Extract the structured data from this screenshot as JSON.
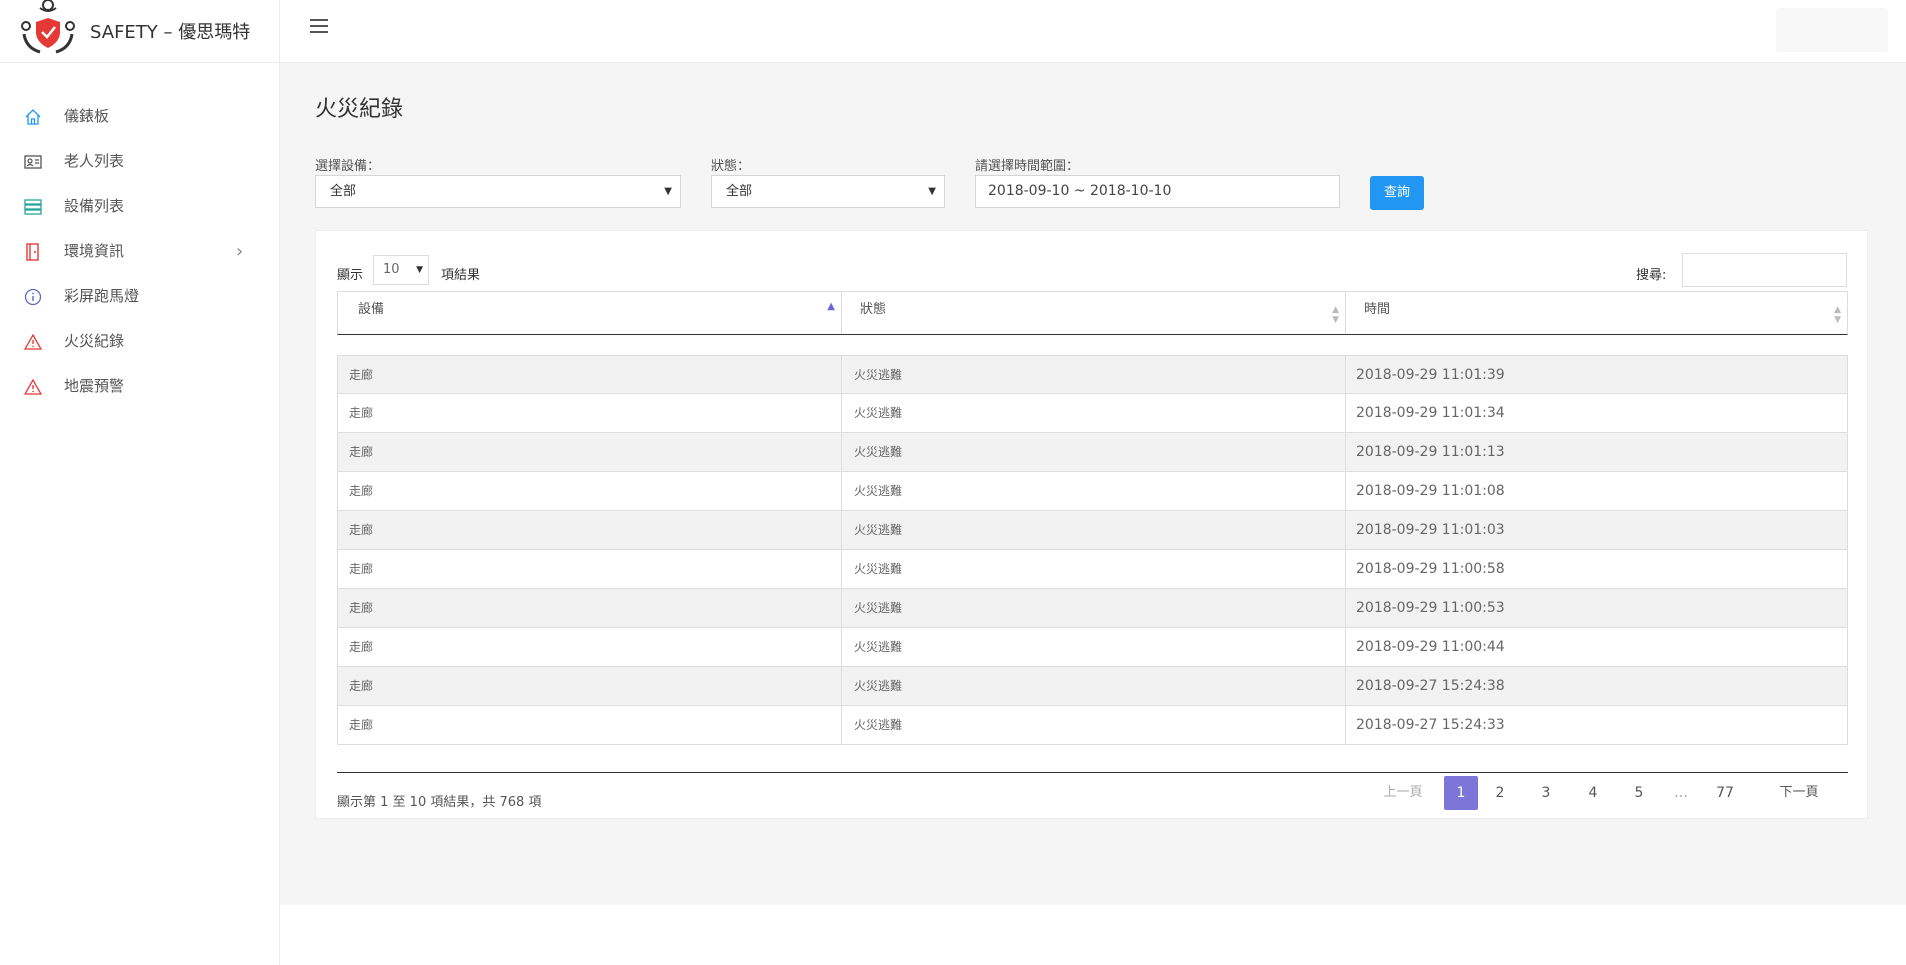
{
  "app": {
    "title": "SAFETY – 優思瑪特"
  },
  "sidebar": {
    "items": [
      {
        "label": "儀錶板",
        "icon": "home-icon",
        "color": "#2196f3"
      },
      {
        "label": "老人列表",
        "icon": "id-card-icon",
        "color": "#555555"
      },
      {
        "label": "設備列表",
        "icon": "server-icon",
        "color": "#26a69a"
      },
      {
        "label": "環境資訊",
        "icon": "door-icon",
        "color": "#e53935",
        "has_submenu": true
      },
      {
        "label": "彩屏跑馬燈",
        "icon": "info-icon",
        "color": "#5c6bc0"
      },
      {
        "label": "火災紀錄",
        "icon": "warning-icon",
        "color": "#e53935"
      },
      {
        "label": "地震預警",
        "icon": "warning-icon",
        "color": "#e53935"
      }
    ]
  },
  "page": {
    "title": "火災紀錄"
  },
  "filters": {
    "device_label": "選擇設備：",
    "device_value": "全部",
    "status_label": "狀態：",
    "status_value": "全部",
    "range_label": "請選擇時間範圍：",
    "range_value": "2018-09-10 ~ 2018-10-10",
    "query_button": "查詢"
  },
  "table_controls": {
    "show_label": "顯示",
    "length_value": "10",
    "results_label": "項結果",
    "search_label": "搜尋:"
  },
  "table": {
    "columns": [
      "設備",
      "狀態",
      "時間"
    ],
    "rows": [
      [
        "走廊",
        "火災逃難",
        "2018-09-29 11:01:39"
      ],
      [
        "走廊",
        "火災逃難",
        "2018-09-29 11:01:34"
      ],
      [
        "走廊",
        "火災逃難",
        "2018-09-29 11:01:13"
      ],
      [
        "走廊",
        "火災逃難",
        "2018-09-29 11:01:08"
      ],
      [
        "走廊",
        "火災逃難",
        "2018-09-29 11:01:03"
      ],
      [
        "走廊",
        "火災逃難",
        "2018-09-29 11:00:58"
      ],
      [
        "走廊",
        "火災逃難",
        "2018-09-29 11:00:53"
      ],
      [
        "走廊",
        "火災逃難",
        "2018-09-29 11:00:44"
      ],
      [
        "走廊",
        "火災逃難",
        "2018-09-27 15:24:38"
      ],
      [
        "走廊",
        "火災逃難",
        "2018-09-27 15:24:33"
      ]
    ]
  },
  "footer": {
    "info": "顯示第 1 至 10 項結果，共 768 項",
    "prev": "上一頁",
    "pages": [
      "1",
      "2",
      "3",
      "4",
      "5",
      "…",
      "77"
    ],
    "next": "下一頁",
    "current_page": "1"
  },
  "colors": {
    "accent": "#2196f3",
    "pager_active": "#7b76d8"
  }
}
